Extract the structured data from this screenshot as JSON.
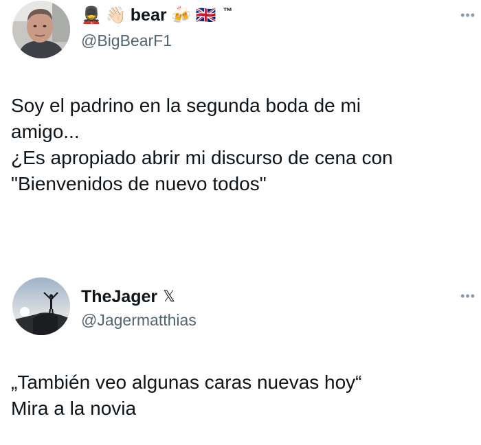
{
  "tweets": [
    {
      "name": "bear",
      "leading_emojis": [
        "💂",
        "👋🏻"
      ],
      "trailing_emojis": [
        "🍻",
        "🇬🇧"
      ],
      "trademark": "™",
      "handle": "@BigBearF1",
      "more": "•••",
      "lines": [
        "Soy el padrino en la segunda boda de mi",
        "amigo...",
        "¿Es apropiado abrir mi discurso de cena con",
        "\"Bienvenidos de nuevo todos\""
      ]
    },
    {
      "name": "TheJager",
      "badge": "𝕏",
      "handle": "@Jagermatthias",
      "more": "•••",
      "lines": [
        "„También veo algunas caras nuevas hoy“",
        "Mira a la novia"
      ]
    }
  ],
  "colors": {
    "text": "#0f1419",
    "secondary": "#536471",
    "background": "#ffffff"
  },
  "icons": {
    "avatar_1": "man-portrait-avatar",
    "avatar_2": "silhouette-on-rock-avatar",
    "more": "more-options-icon",
    "badge": "x-logo-icon"
  }
}
